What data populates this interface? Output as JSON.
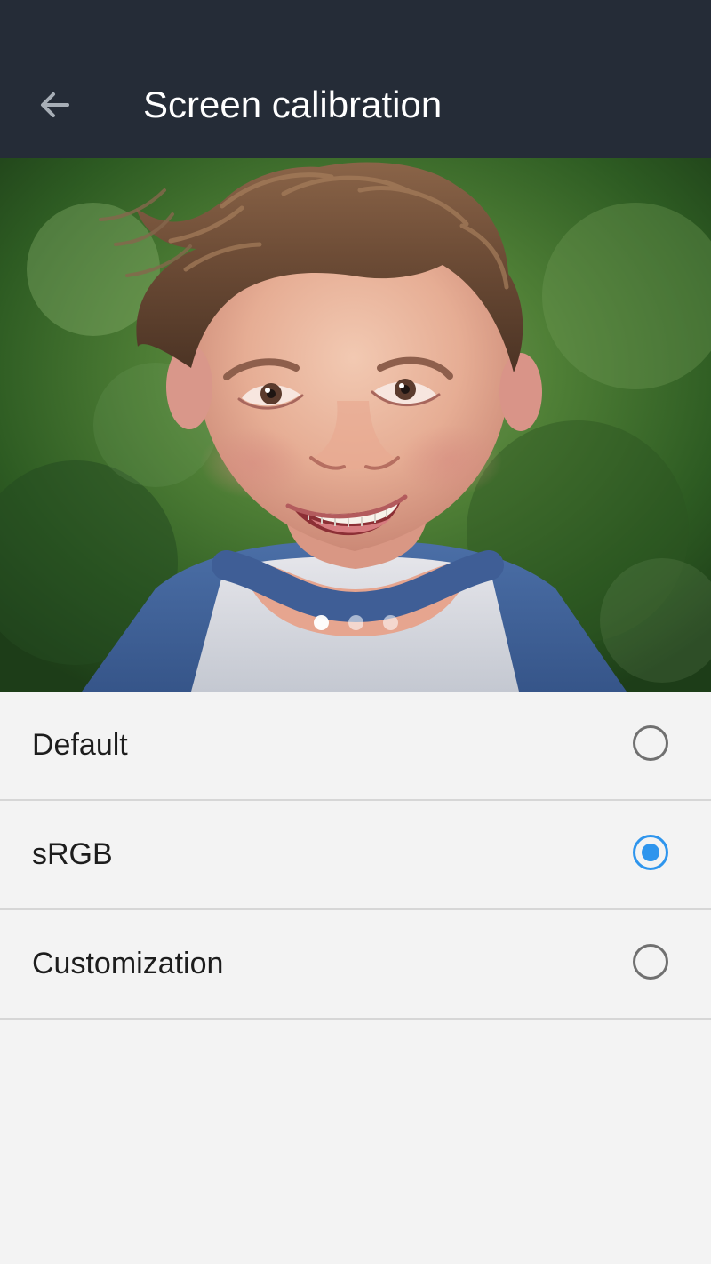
{
  "header": {
    "title": "Screen calibration",
    "back_icon": "arrow-left-icon",
    "background_color": "#252c37"
  },
  "preview": {
    "image_subject": "smiling child portrait",
    "pager": {
      "total": 3,
      "active_index": 0
    }
  },
  "options": [
    {
      "label": "Default",
      "selected": false
    },
    {
      "label": "sRGB",
      "selected": true
    },
    {
      "label": "Customization",
      "selected": false
    }
  ],
  "colors": {
    "accent": "#2e95ed",
    "background": "#f3f3f3",
    "text": "#1d1d1d",
    "divider": "#d6d6d6"
  }
}
